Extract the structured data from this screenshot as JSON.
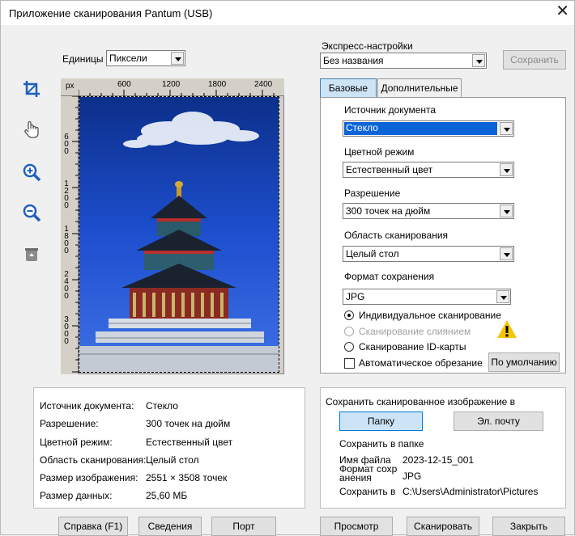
{
  "window": {
    "title": "Приложение сканирования Pantum (USB)",
    "close_glyph": "✕"
  },
  "units": {
    "label": "Единицы",
    "value": "Пиксели"
  },
  "express": {
    "label": "Экспресс-настройки",
    "value": "Без названия",
    "save_label": "Сохранить"
  },
  "toolbar": {
    "items": [
      {
        "name": "crop-icon"
      },
      {
        "name": "hand-icon"
      },
      {
        "name": "zoom-in-icon"
      },
      {
        "name": "zoom-out-icon"
      },
      {
        "name": "recycle-bin-icon"
      }
    ]
  },
  "ruler": {
    "unit": "px",
    "top_ticks": [
      "600",
      "1200",
      "1800",
      "2400"
    ],
    "left_ticks": [
      "600",
      "1200",
      "1800",
      "2400",
      "3000"
    ]
  },
  "tabs": {
    "basic": "Базовые",
    "advanced": "Дополнительные"
  },
  "settings": {
    "source_label": "Источник документа",
    "source_value": "Стекло",
    "color_label": "Цветной режим",
    "color_value": "Естественный цвет",
    "resolution_label": "Разрешение",
    "resolution_value": "300 точек на дюйм",
    "area_label": "Область сканирования",
    "area_value": "Целый стол",
    "format_label": "Формат сохранения",
    "format_value": "JPG",
    "radio_individual": "Индивидуальное сканирование",
    "radio_merge": "Сканирование слиянием",
    "radio_id": "Сканирование ID-карты",
    "auto_crop": "Автоматическое обрезание",
    "default_label": "По умолчанию",
    "warning_icon": "warning-icon",
    "warning_color": "#f5c400"
  },
  "summary": {
    "rows": [
      {
        "key": "Источник документа:",
        "val": "Стекло"
      },
      {
        "key": "Разрешение:",
        "val": "300 точек на дюйм"
      },
      {
        "key": "Цветной режим:",
        "val": "Естественный цвет"
      },
      {
        "key": "Область сканирования:",
        "val": "Целый стол"
      },
      {
        "key": "Размер изображения:",
        "val": "2551 × 3508  точек"
      },
      {
        "key": "Размер данных:",
        "val": "25,60 МБ"
      }
    ]
  },
  "save": {
    "title": "Сохранить сканированное изображение в",
    "folder_btn": "Папку",
    "email_btn": "Эл. почту",
    "subtitle": "Сохранить в папке",
    "filename_label": "Имя файла",
    "filename_value": "2023-12-15_001",
    "format_label": "Формат сохр анения",
    "format_value": "JPG",
    "path_label": "Сохранить в",
    "path_value": "C:\\Users\\Administrator\\Pictures"
  },
  "bottom": {
    "help": "Справка (F1)",
    "info": "Сведения",
    "port": "Порт",
    "preview": "Просмотр",
    "scan": "Сканировать",
    "close": "Закрыть"
  },
  "colors": {
    "accent": "#0a64d8",
    "tab_active": "#cde4f7"
  }
}
